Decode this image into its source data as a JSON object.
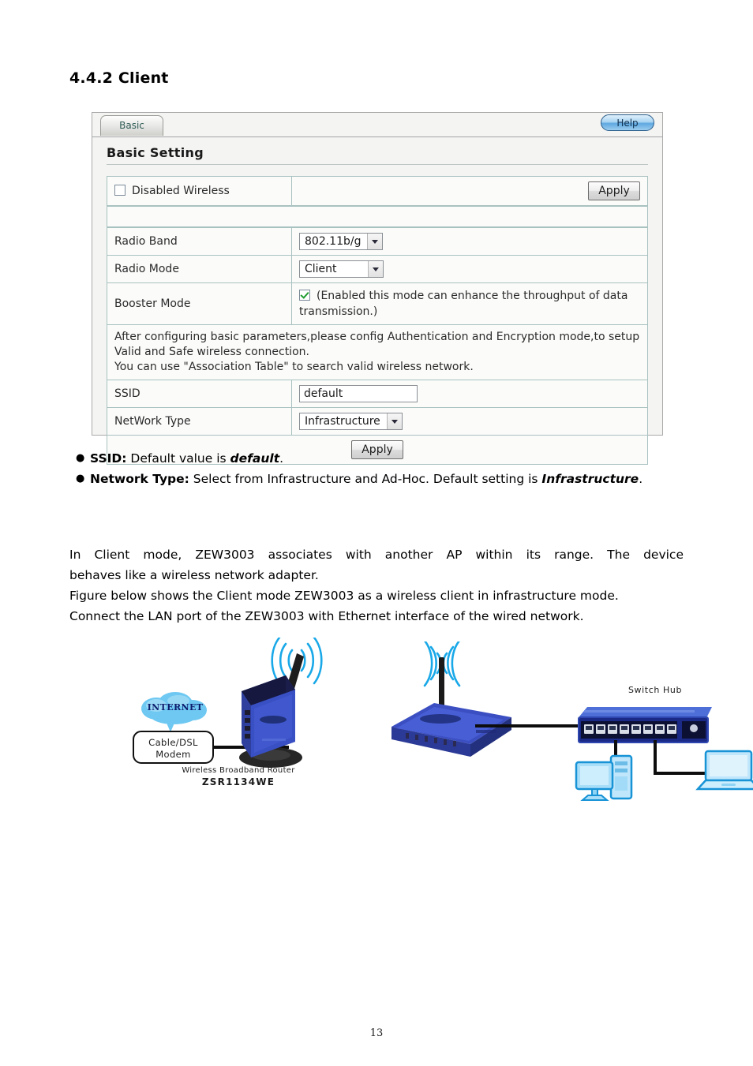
{
  "heading": "4.4.2 Client",
  "panel": {
    "tab_label": "Basic",
    "help_label": "Help",
    "section_title": "Basic Setting",
    "disabled_wireless": {
      "label": "Disabled Wireless",
      "checked": false,
      "apply_label": "Apply"
    },
    "rows": {
      "radio_band": {
        "label": "Radio Band",
        "value": "802.11b/g"
      },
      "radio_mode": {
        "label": "Radio Mode",
        "value": "Client"
      },
      "booster_mode": {
        "label": "Booster Mode",
        "checked": true,
        "description": "(Enabled this mode can enhance the throughput of data transmission.)"
      },
      "note": "After configuring basic parameters,please config Authentication and Encryption mode,to setup Valid and Safe wireless connection.\nYou can use \"Association Table\" to search valid wireless network.",
      "note_line1": "After configuring basic parameters,please config Authentication and Encryption mode,to setup Valid and Safe wireless connection.",
      "note_line2": "You can use \"Association Table\" to search valid wireless network.",
      "ssid": {
        "label": "SSID",
        "value": "default"
      },
      "network_type": {
        "label": "NetWork Type",
        "value": "Infrastructure"
      }
    },
    "apply_label": "Apply"
  },
  "bullets": [
    {
      "marker": "●",
      "term": "SSID:",
      "text": " Default value is ",
      "emphasis": "default",
      "tail": "."
    },
    {
      "marker": "●",
      "term": "Network Type:",
      "text": " Select from Infrastructure and Ad-Hoc. Default setting is ",
      "emphasis": "Infrastructure",
      "tail": "."
    }
  ],
  "paragraph": {
    "line1": "In Client mode, ZEW3003 associates with another AP within its range. The device",
    "line2": "behaves like a wireless network adapter.",
    "line3": "Figure below shows the Client mode ZEW3003 as a wireless client in infrastructure mode.",
    "line4": "Connect the LAN port of the ZEW3003 with Ethernet interface of the wired network."
  },
  "diagram": {
    "cloud_label": "INTERNET",
    "modem_line1": "Cable/DSL",
    "modem_line2": "Modem",
    "router_caption": "Wireless Broadband Router",
    "router_model": "ZSR1134WE",
    "switch_label": "Switch Hub",
    "colors": {
      "device_blue": "#2b3fa8",
      "signal_blue": "#19a8e8",
      "cloud_blue": "#63c4f0",
      "wire_black": "#0d0d0d"
    }
  },
  "page_number": "13"
}
